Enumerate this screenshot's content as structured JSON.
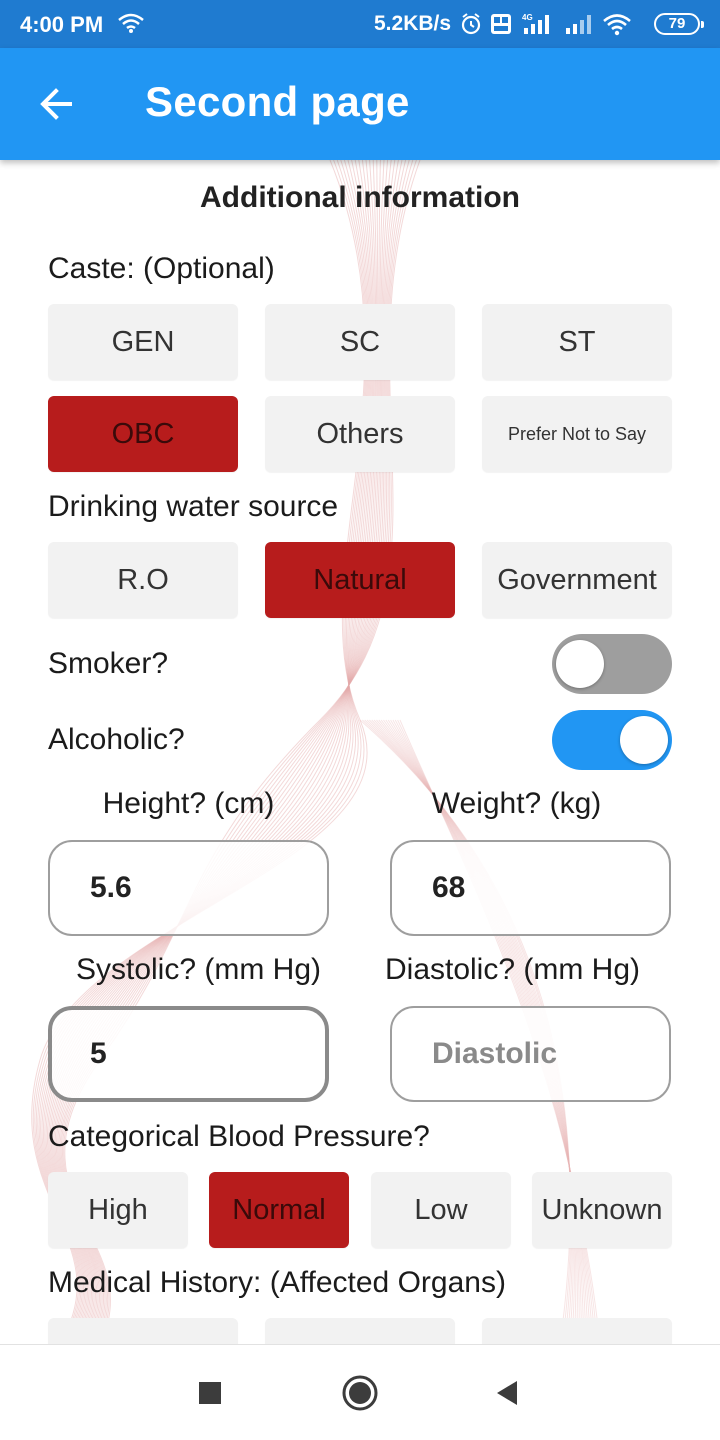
{
  "status_bar": {
    "time": "4:00 PM",
    "network_speed": "5.2KB/s",
    "battery": "79",
    "icons": [
      "wifi-icon",
      "alarm-icon",
      "volte-icon",
      "4g-signal-icon",
      "signal-icon",
      "wifi-icon",
      "battery-icon"
    ]
  },
  "app_bar": {
    "title": "Second page",
    "back_icon": "arrow-left-icon",
    "color": "#2196f3"
  },
  "form": {
    "heading": "Additional information",
    "caste": {
      "label": "Caste: (Optional)",
      "options": [
        "GEN",
        "SC",
        "ST",
        "OBC",
        "Others",
        "Prefer Not to Say"
      ],
      "selected": "OBC"
    },
    "water": {
      "label": "Drinking water source",
      "options": [
        "R.O",
        "Natural",
        "Government"
      ],
      "selected": "Natural"
    },
    "smoker": {
      "label": "Smoker?",
      "value": false
    },
    "alcoholic": {
      "label": "Alcoholic?",
      "value": true
    },
    "height": {
      "label": "Height? (cm)",
      "value": "5.6"
    },
    "weight": {
      "label": "Weight? (kg)",
      "value": "68"
    },
    "systolic": {
      "label": "Systolic? (mm Hg)",
      "value": "5"
    },
    "diastolic": {
      "label": "Diastolic? (mm Hg)",
      "placeholder": "Diastolic"
    },
    "bp_category": {
      "label": "Categorical Blood Pressure?",
      "options": [
        "High",
        "Normal",
        "Low",
        "Unknown"
      ],
      "selected": "Normal"
    },
    "medical_history": {
      "label": "Medical History: (Affected Organs)"
    },
    "selected_color": "#b71c1c",
    "chip_color": "#f2f2f2"
  },
  "nav_bar": {
    "icons": [
      "recents-square-icon",
      "home-circle-icon",
      "back-triangle-icon"
    ]
  }
}
